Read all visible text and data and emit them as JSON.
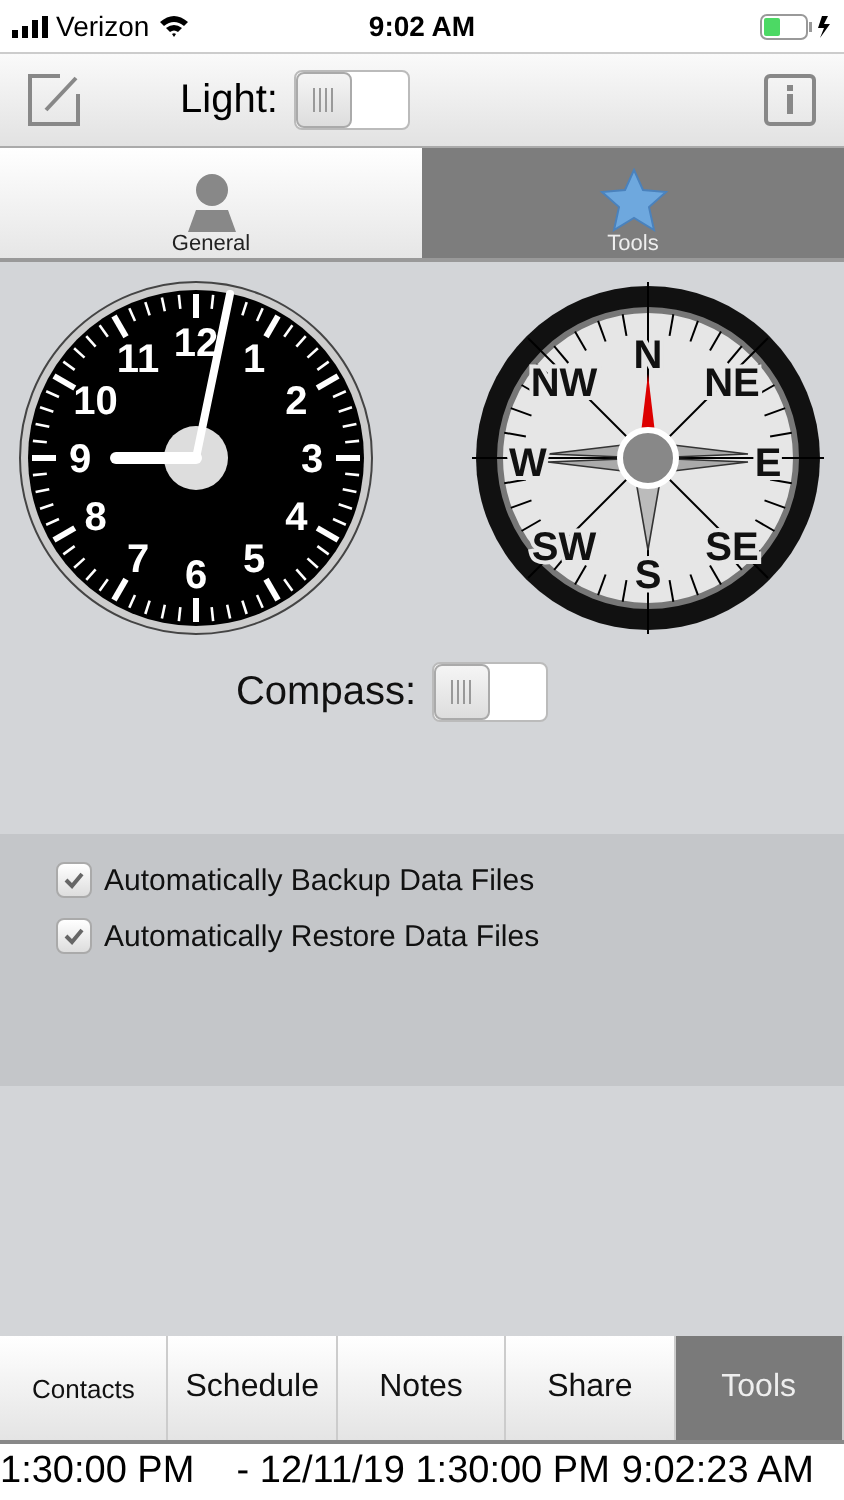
{
  "status_bar": {
    "carrier": "Verizon",
    "time": "9:02 AM"
  },
  "toolbar": {
    "light_label": "Light:",
    "light_on": false
  },
  "tabs": [
    {
      "label": "General",
      "kind": "person",
      "selected": false
    },
    {
      "label": "Tools",
      "kind": "star",
      "selected": true
    }
  ],
  "clock": {
    "numbers": [
      "11",
      "12",
      "1",
      "10",
      "2",
      "9",
      "3",
      "8",
      "4",
      "7",
      "6",
      "5"
    ]
  },
  "compass": {
    "labels": [
      "N",
      "NW",
      "NE",
      "W",
      "E",
      "SW",
      "SE",
      "S"
    ]
  },
  "compass_toggle": {
    "label": "Compass:",
    "on": false
  },
  "options": [
    {
      "label": "Automatically Backup Data Files",
      "checked": true
    },
    {
      "label": "Automatically Restore Data Files",
      "checked": true
    }
  ],
  "bottom_tabs": [
    {
      "label": "Contacts",
      "selected": false
    },
    {
      "label": "Schedule",
      "selected": false
    },
    {
      "label": "Notes",
      "selected": false
    },
    {
      "label": "Share",
      "selected": false
    },
    {
      "label": "Tools",
      "selected": true
    }
  ],
  "ticker": {
    "text": "1:30:00 PM    - 12/11/19 1:30:00 PM",
    "clock": "9:02:23 AM"
  }
}
